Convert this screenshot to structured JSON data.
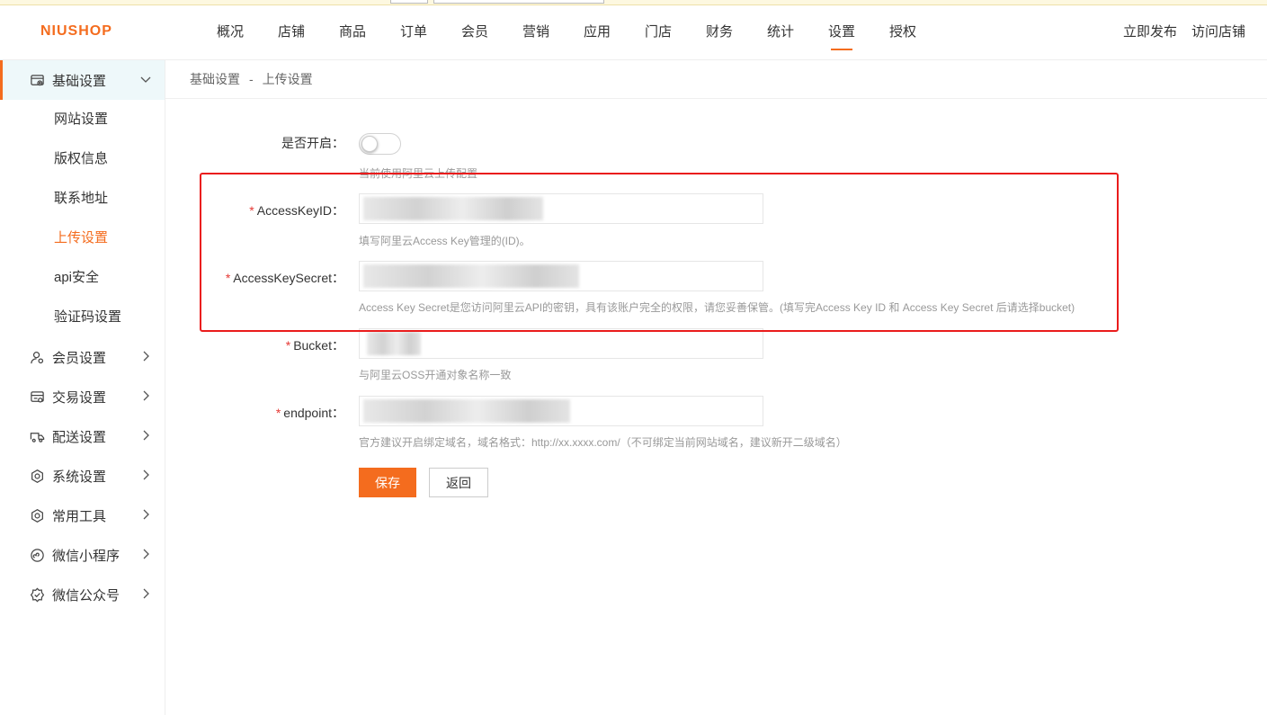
{
  "header": {
    "logo": "NIUSHOP",
    "nav": [
      "概况",
      "店铺",
      "商品",
      "订单",
      "会员",
      "营销",
      "应用",
      "门店",
      "财务",
      "统计",
      "设置",
      "授权"
    ],
    "active_nav": "设置",
    "publish": "立即发布",
    "visit_store": "访问店铺"
  },
  "sidebar": {
    "basic_group": "基础设置",
    "basic_items": [
      "网站设置",
      "版权信息",
      "联系地址",
      "上传设置",
      "api安全",
      "验证码设置"
    ],
    "active_item": "上传设置",
    "groups": [
      "会员设置",
      "交易设置",
      "配送设置",
      "系统设置",
      "常用工具",
      "微信小程序",
      "微信公众号"
    ]
  },
  "breadcrumb": {
    "parent": "基础设置",
    "separator": "-",
    "current": "上传设置"
  },
  "form": {
    "enable_label": "是否开启：",
    "enable_hint": "当前使用阿里云上传配置",
    "key_id_label": "AccessKeyID：",
    "key_id_hint": "填写阿里云Access Key管理的(ID)。",
    "key_secret_label": "AccessKeySecret：",
    "key_secret_hint": "Access Key Secret是您访问阿里云API的密钥，具有该账户完全的权限，请您妥善保管。(填写完Access Key ID 和 Access Key Secret 后请选择bucket)",
    "bucket_label": "Bucket：",
    "bucket_hint": "与阿里云OSS开通对象名称一致",
    "endpoint_label": "endpoint：",
    "endpoint_hint": "官方建议开启绑定域名，域名格式：http://xx.xxxx.com/（不可绑定当前网站域名，建议新开二级域名）",
    "required_mark": "*",
    "save_label": "保存",
    "back_label": "返回"
  },
  "colors": {
    "accent": "#f46c1e",
    "highlight_box": "#ea1c1c",
    "active_bg": "#eef8fa"
  }
}
